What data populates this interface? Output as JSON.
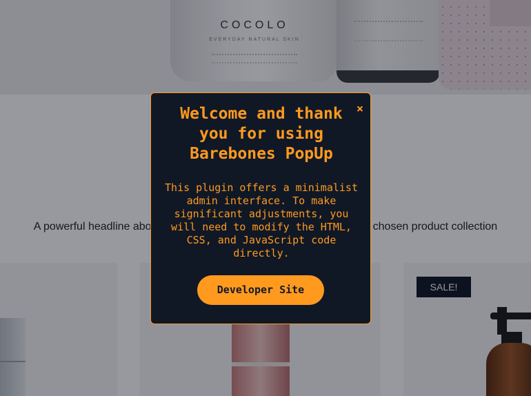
{
  "hero": {
    "brand_text": "COCOLO",
    "brand_sub": "EVERYDAY NATURAL SKIN"
  },
  "section": {
    "headline": "A powerful headline about your product features to give focus to your chosen product collection"
  },
  "products": [
    {
      "badge": ""
    },
    {
      "badge": ""
    },
    {
      "badge": "SALE!"
    }
  ],
  "popup": {
    "close_icon": "×",
    "title": "Welcome and thank you for using Barebones PopUp",
    "body": "This plugin offers a minimalist admin interface. To make significant adjustments, you will need to modify the HTML, CSS, and JavaScript code directly.",
    "cta_label": "Developer Site"
  },
  "colors": {
    "accent": "#ff9a1f",
    "popup_background": "#101826",
    "badge_background": "#111827"
  },
  "icons": {
    "close": "close-icon"
  }
}
